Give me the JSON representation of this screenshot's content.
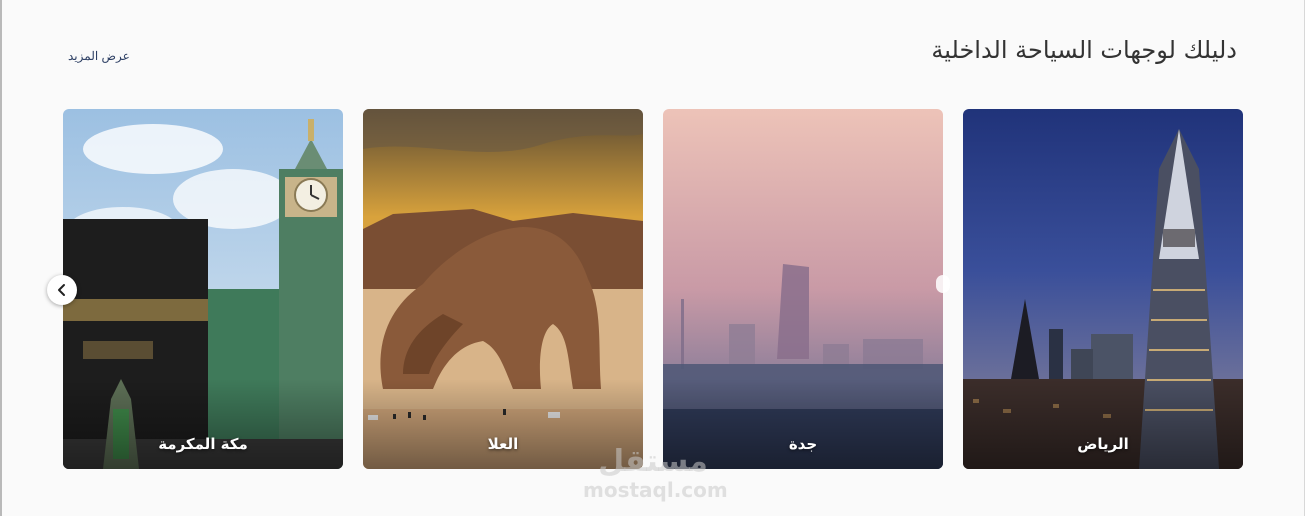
{
  "section": {
    "title": "دليلك لوجهات السياحة الداخلية",
    "see_more": "عرض المزيد"
  },
  "cards": [
    {
      "name": "الرياض"
    },
    {
      "name": "جدة"
    },
    {
      "name": "العلا"
    },
    {
      "name": "مكة المكرمة"
    }
  ],
  "watermark": {
    "arabic": "مستقل",
    "latin": "mostaql.com"
  }
}
